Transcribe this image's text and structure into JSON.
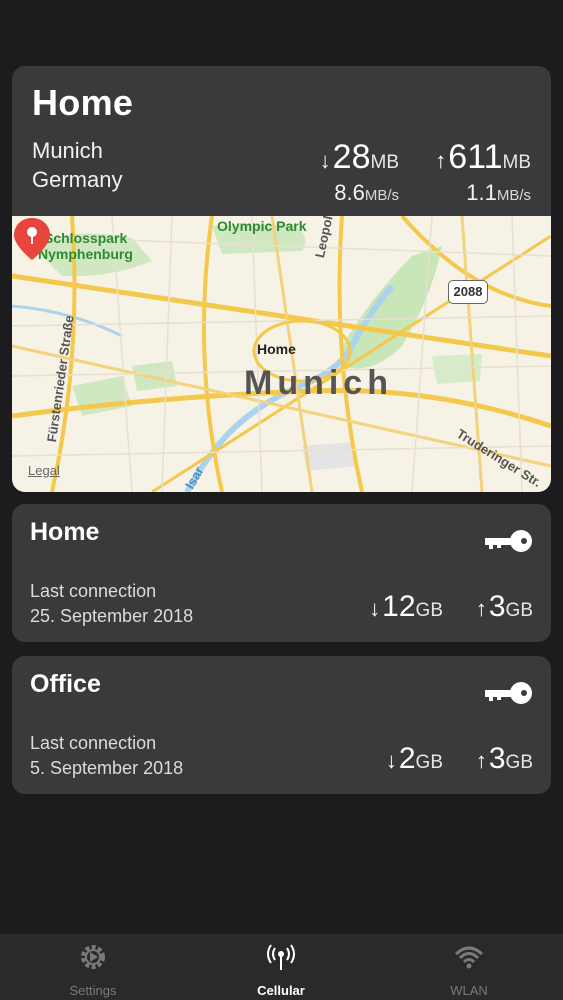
{
  "main_card": {
    "title": "Home",
    "city": "Munich",
    "country": "Germany",
    "download": {
      "arrow": "↓",
      "value": "28",
      "unit": "MB",
      "rate": "8.6",
      "rate_unit": "MB/s"
    },
    "upload": {
      "arrow": "↑",
      "value": "611",
      "unit": "MB",
      "rate": "1.1",
      "rate_unit": "MB/s"
    },
    "map": {
      "labels": {
        "park1_line1": "Schlosspark",
        "park1_line2": "Nymphenburg",
        "park2": "Olympic Park",
        "street1": "Leopoldstraße",
        "street2": "Fürstenrieder Straße",
        "street3": "Truderinger Str.",
        "street4": "Isar",
        "city": "Munich",
        "road_shield": "2088",
        "pin": "Home",
        "legal": "Legal"
      },
      "pin_color": "#e8453c"
    }
  },
  "networks": [
    {
      "name": "Home",
      "last_label": "Last connection",
      "last_date": "25. September 2018",
      "down_arrow": "↓",
      "down_value": "12",
      "down_unit": "GB",
      "up_arrow": "↑",
      "up_value": "3",
      "up_unit": "GB",
      "icon": "key-icon"
    },
    {
      "name": "Office",
      "last_label": "Last connection",
      "last_date": "5. September 2018",
      "down_arrow": "↓",
      "down_value": "2",
      "down_unit": "GB",
      "up_arrow": "↑",
      "up_value": "3",
      "up_unit": "GB",
      "icon": "key-icon"
    }
  ],
  "tabbar": {
    "tabs": [
      {
        "label": "Settings",
        "icon": "gear-icon",
        "active": false
      },
      {
        "label": "Cellular",
        "icon": "antenna-icon",
        "active": true
      },
      {
        "label": "WLAN",
        "icon": "wifi-icon",
        "active": false
      }
    ]
  },
  "colors": {
    "background": "#1c1c1e",
    "card": "#3a3a3c",
    "tabbar": "#2a2a2c",
    "inactive_tab": "#7a7a7a",
    "active_tab": "#ffffff"
  }
}
